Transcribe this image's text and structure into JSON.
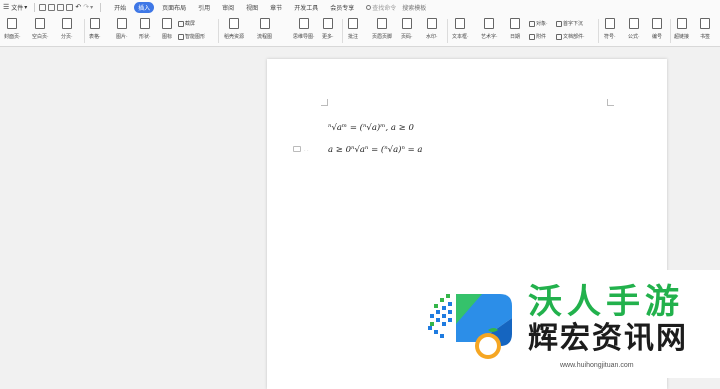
{
  "topbar": {
    "file_menu": "文件",
    "tabs": [
      "开始",
      "插入",
      "页面布局",
      "引用",
      "审阅",
      "视图",
      "章节",
      "开发工具",
      "会员专享"
    ],
    "active_tab": "插入",
    "search_placeholder": "查找命令",
    "search_templates": "搜索模板"
  },
  "ribbon": {
    "big_buttons": [
      {
        "label": "封面页·"
      },
      {
        "label": "空白页·"
      },
      {
        "label": "分页·"
      },
      {
        "label": "表格·"
      },
      {
        "label": "图片·"
      },
      {
        "label": "形状·"
      },
      {
        "label": "图标"
      },
      {
        "label": "稻壳资源"
      },
      {
        "label": "流程图"
      },
      {
        "label": "思维导图·"
      },
      {
        "label": "更多·"
      },
      {
        "label": "批注"
      },
      {
        "label": "页眉页脚"
      },
      {
        "label": "页码·"
      },
      {
        "label": "水印·"
      },
      {
        "label": "文本框·"
      },
      {
        "label": "艺术字·"
      },
      {
        "label": "日期"
      },
      {
        "label": "符号·"
      },
      {
        "label": "公式·"
      },
      {
        "label": "编号"
      },
      {
        "label": "超链接"
      },
      {
        "label": "书签"
      }
    ],
    "small_buttons": {
      "screenshot": "截屏",
      "smart_graphic": "智能图形",
      "object": "对象·",
      "first_letter": "首字下沉",
      "attachment": "附件",
      "doc_part": "文档部件·"
    }
  },
  "document": {
    "formula_1": "ⁿ√aᵐ = (ⁿ√a)ᵐ, a ≥ 0",
    "formula_2": "a ≥ 0ⁿ√aⁿ = (ⁿ√a)ⁿ = a",
    "paragraph_dots": "· ·"
  },
  "watermark": {
    "top_text": "沃人手游",
    "bottom_text": "辉宏资讯网",
    "url": "www.huihongjituan.com"
  }
}
